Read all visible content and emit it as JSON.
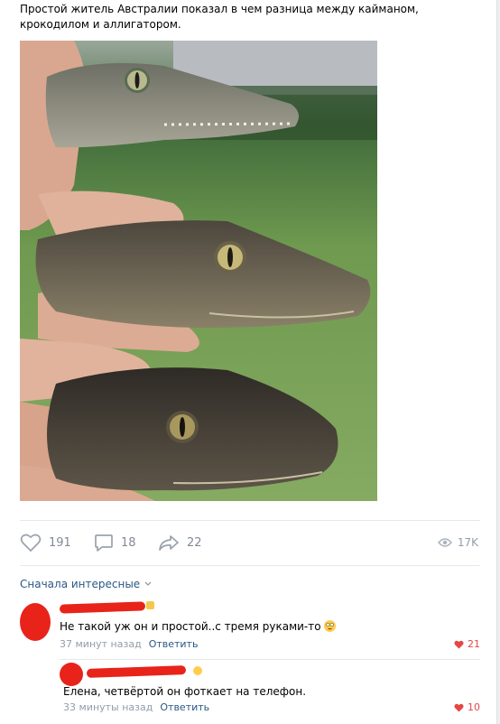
{
  "post": {
    "text": "Простой житель Австралии показал в чем разница между кайманом, крокодилом и аллигатором.",
    "photo_alt": "crocodile-photo"
  },
  "actions": {
    "likes": "191",
    "comments": "18",
    "shares": "22",
    "views": "17K"
  },
  "comments_section": {
    "sort_label": "Сначала интересные"
  },
  "comments": [
    {
      "text": "Не такой уж он и простой..с тремя руками-то",
      "time": "37 минут назад",
      "reply_label": "Ответить",
      "likes": "21"
    },
    {
      "text": "Елена, четвёртой он фоткает на телефон.",
      "time": "33 минуты назад",
      "reply_label": "Ответить",
      "likes": "10"
    }
  ],
  "colors": {
    "link": "#2a5885",
    "meta": "#939cab",
    "like_red": "#e64646",
    "redact_red": "#e8231a"
  }
}
